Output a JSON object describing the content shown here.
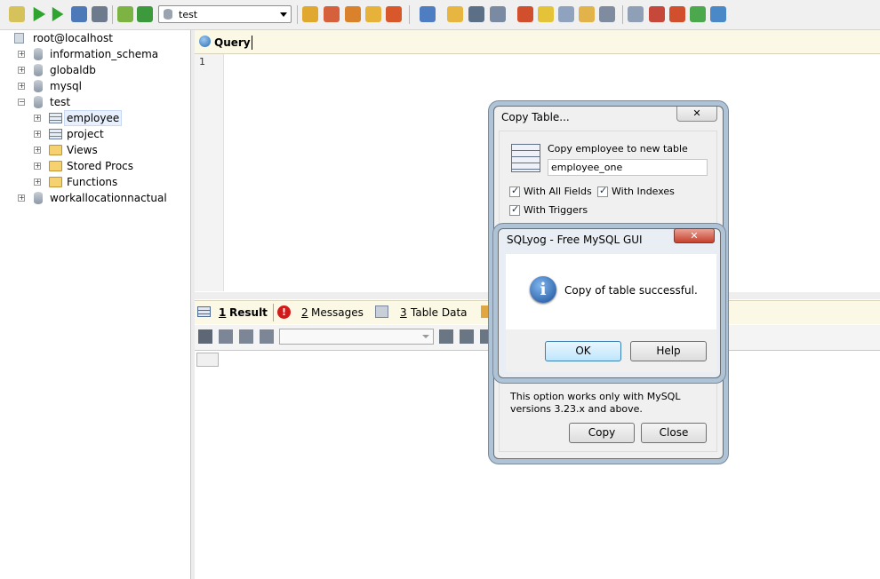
{
  "toolbar": {
    "database_select": "test",
    "icons": [
      "connect-icon",
      "execute-icon",
      "execute-all-icon",
      "results-icon",
      "refresh-icon",
      "edit-icon",
      "reload-icon",
      "create-db-icon",
      "create-table-icon",
      "backup-icon",
      "restore-icon",
      "import-icon",
      "user-manager-icon",
      "clear-icon",
      "search-icon",
      "view-mode-icon",
      "schema-icon",
      "query-builder-icon",
      "designer-icon",
      "history-icon",
      "export-icon",
      "sync-icon",
      "transfer-icon",
      "scheduled-icon",
      "notify-icon",
      "excel-icon",
      "tree-icon"
    ]
  },
  "tree": {
    "root": "root@localhost",
    "databases": [
      "information_schema",
      "globaldb",
      "mysql",
      "test"
    ],
    "test_children": [
      "employee",
      "project",
      "Views",
      "Stored Procs",
      "Functions"
    ],
    "last_db": "workallocationnactual"
  },
  "editor": {
    "tab_label": "Query",
    "line_number": "1"
  },
  "results": {
    "tabs": [
      {
        "num": "1",
        "label": "Result"
      },
      {
        "num": "2",
        "label": "Messages"
      },
      {
        "num": "3",
        "label": "Table Data"
      }
    ]
  },
  "copy_dialog": {
    "title": "Copy Table...",
    "prompt": "Copy employee to new table",
    "new_name": "employee_one",
    "opt_all_fields": "With All Fields",
    "opt_indexes": "With Indexes",
    "opt_triggers": "With Triggers",
    "note": "This option works only with MySQL versions 3.23.x and above.",
    "copy_btn": "Copy",
    "close_btn": "Close"
  },
  "msg_dialog": {
    "title": "SQLyog - Free MySQL GUI",
    "message": "Copy of table successful.",
    "ok_btn": "OK",
    "help_btn": "Help"
  },
  "colors": {
    "accent": "#2b5fb4",
    "tabbar": "#fbf8e6",
    "close_red": "#c6402c"
  }
}
